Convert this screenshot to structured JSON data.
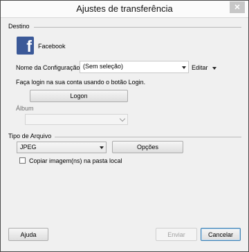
{
  "window": {
    "title": "Ajustes de transferência",
    "close_label": "✕"
  },
  "destination": {
    "section_label": "Destino",
    "service_name": "Facebook",
    "logo_glyph": "f",
    "config_label": "Nome da Configuração:",
    "config_value": "(Sem seleção)",
    "edit_label": "Editar"
  },
  "login": {
    "instruction": "Faça login na sua conta usando o botão Login.",
    "logon_button": "Logon",
    "album_label": "Álbum",
    "album_value": ""
  },
  "file_type": {
    "section_label": "Tipo de Arquivo",
    "format_value": "JPEG",
    "options_button": "Opções",
    "copy_checkbox_label": "Copiar imagem(ns) na pasta local",
    "copy_checked": false
  },
  "footer": {
    "help_button": "Ajuda",
    "send_button": "Enviar",
    "cancel_button": "Cancelar"
  },
  "colors": {
    "facebook_blue": "#3b5998",
    "accent_border": "#3c7fb1"
  }
}
